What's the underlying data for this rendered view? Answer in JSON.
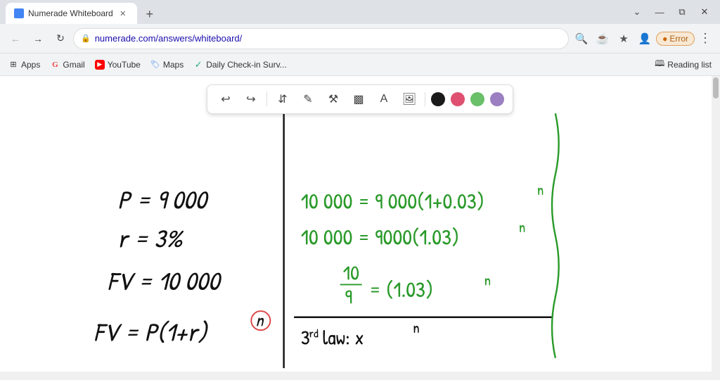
{
  "browser": {
    "tab": {
      "title": "Numerade Whiteboard",
      "favicon_color": "#4285f4"
    },
    "address": "numerade.com/answers/whiteboard/",
    "bookmarks": [
      {
        "label": "Apps",
        "icon": "⊞"
      },
      {
        "label": "Gmail",
        "icon": "G"
      },
      {
        "label": "YouTube",
        "icon": "▶"
      },
      {
        "label": "Maps",
        "icon": "📍"
      },
      {
        "label": "Daily Check-in Surv...",
        "icon": "✓"
      }
    ],
    "reading_list_label": "Reading list",
    "error_label": "Error"
  },
  "toolbar": {
    "undo_label": "undo",
    "redo_label": "redo",
    "select_label": "select",
    "pen_label": "pen",
    "tools_label": "tools",
    "highlighter_label": "highlighter",
    "text_label": "text",
    "image_label": "image",
    "colors": [
      {
        "name": "black",
        "hex": "#1a1a1a"
      },
      {
        "name": "red",
        "hex": "#e05070"
      },
      {
        "name": "green",
        "hex": "#6abf69"
      },
      {
        "name": "purple",
        "hex": "#9b7fc0"
      }
    ]
  }
}
